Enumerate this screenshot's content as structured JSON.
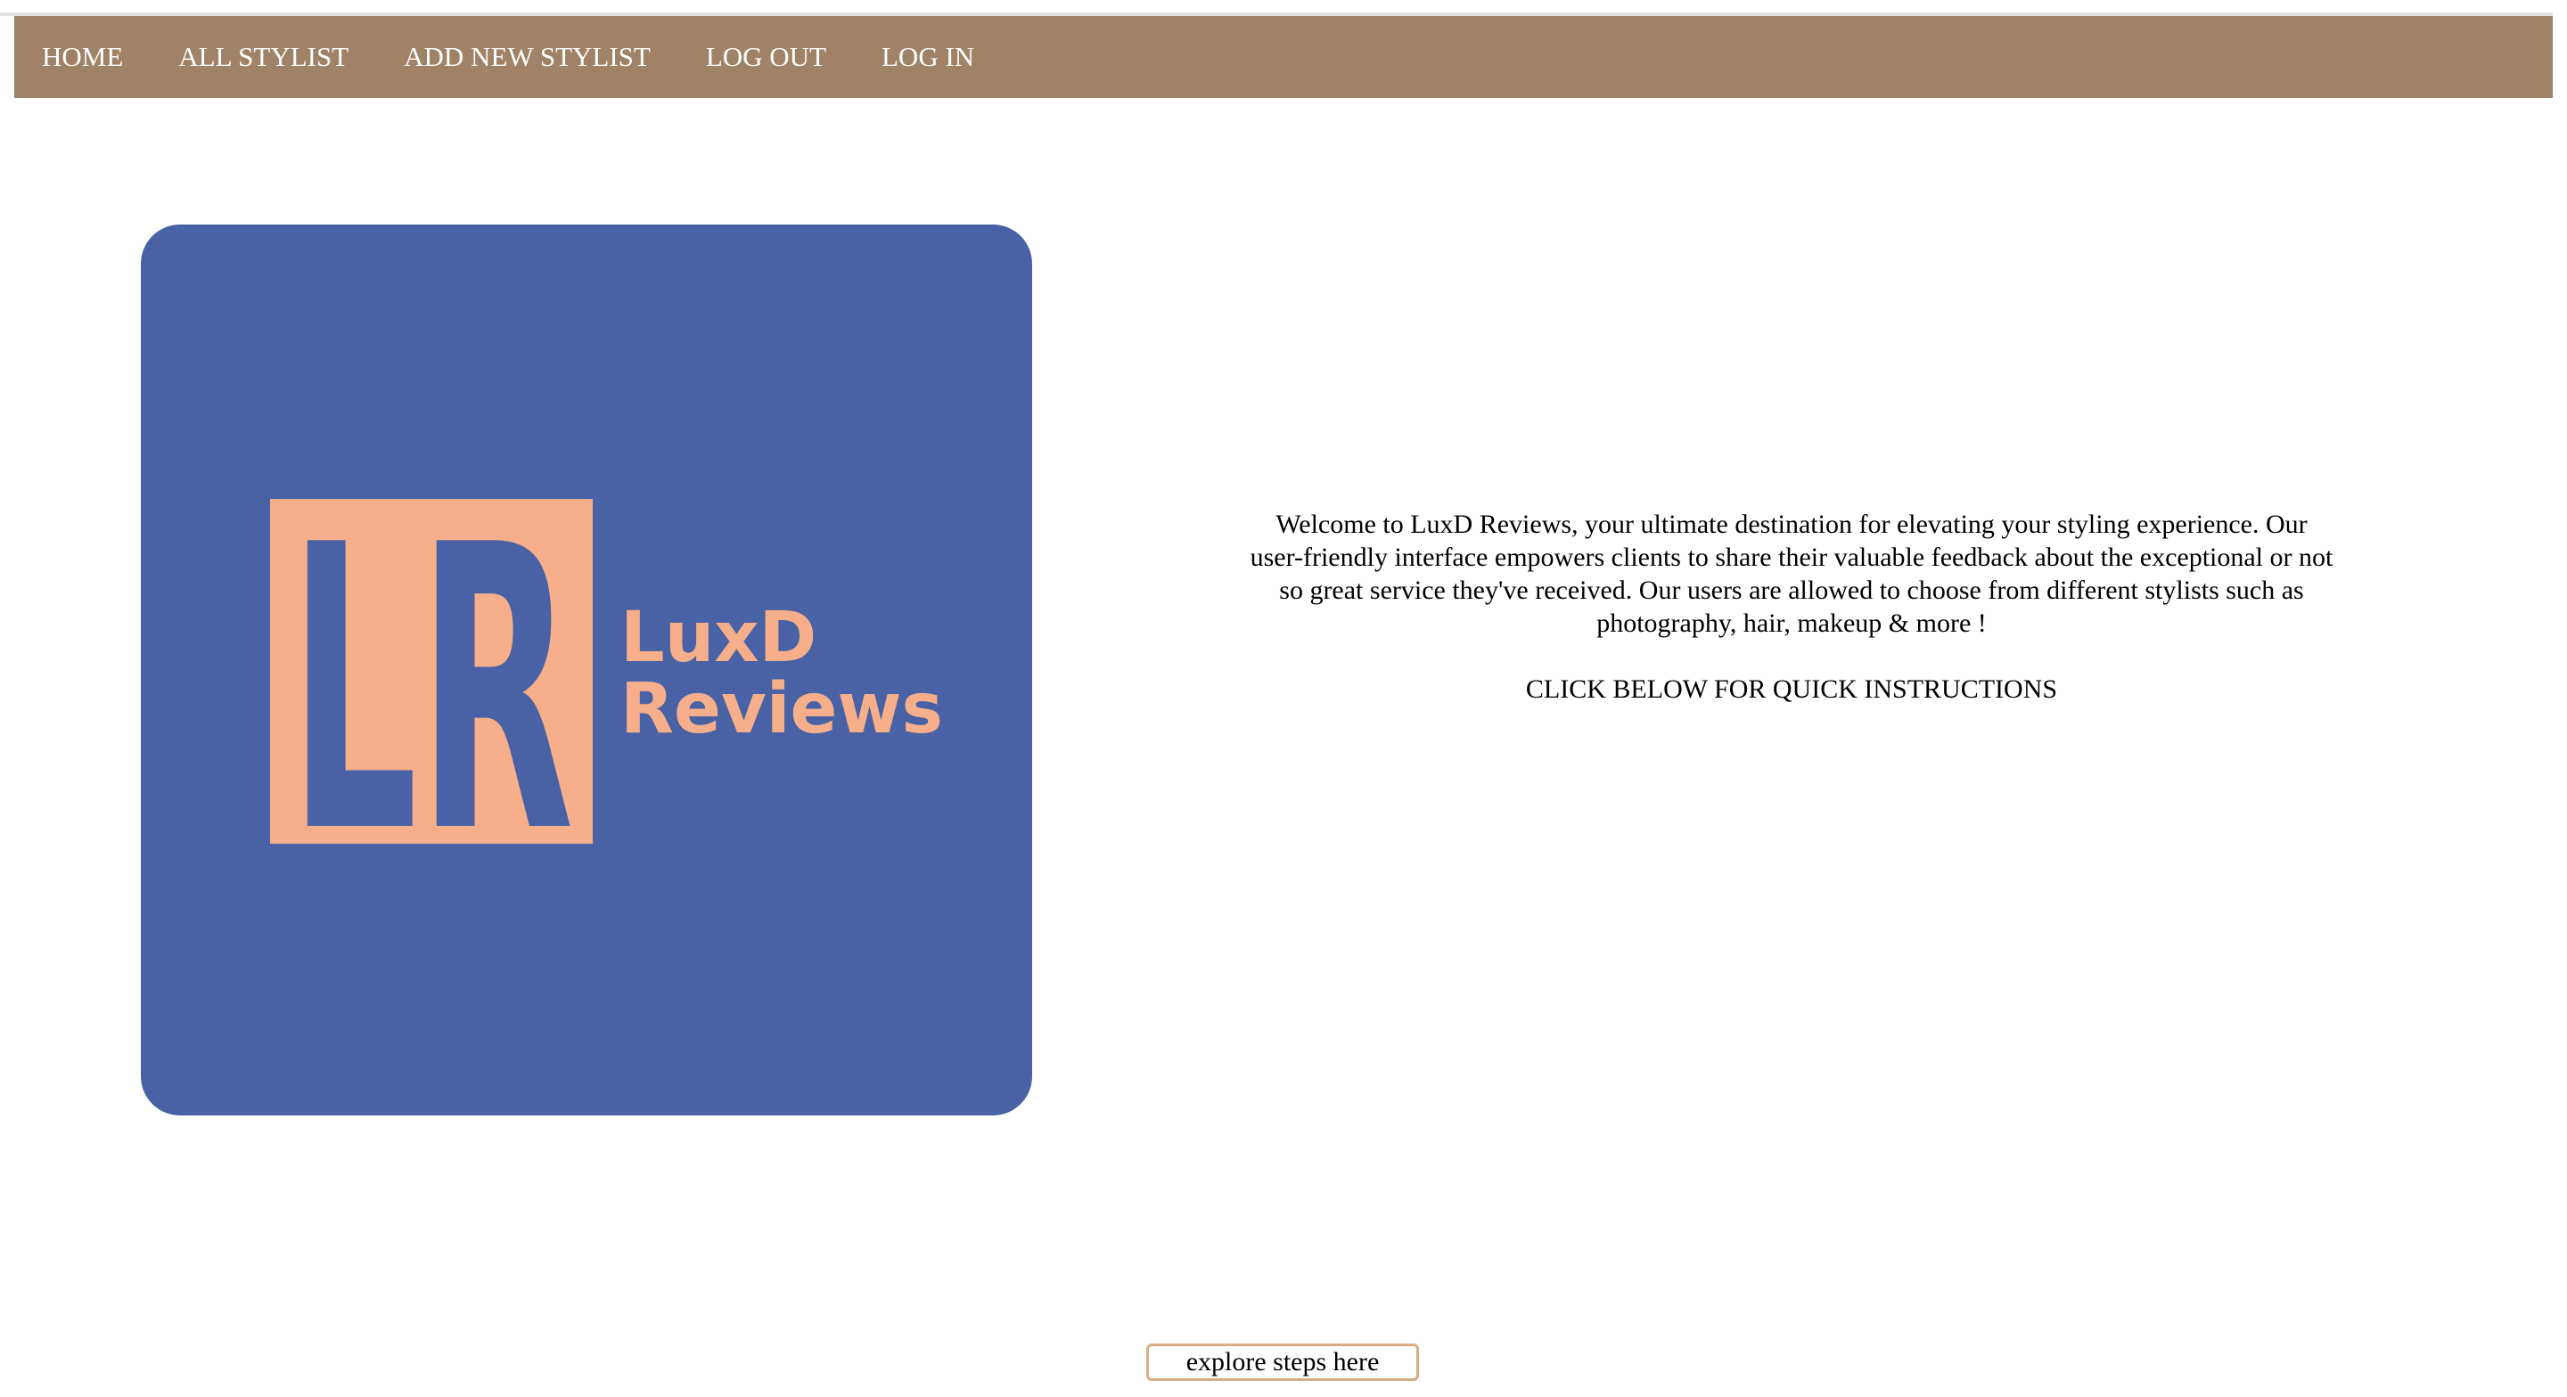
{
  "nav": {
    "items": [
      {
        "label": "HOME"
      },
      {
        "label": "ALL STYLIST"
      },
      {
        "label": "ADD NEW STYLIST"
      },
      {
        "label": "LOG OUT"
      },
      {
        "label": "LOG IN"
      }
    ]
  },
  "logo": {
    "monogram": "LR",
    "wordmark_line1": "LuxD",
    "wordmark_line2": "Reviews",
    "colors": {
      "background": "#4862a5",
      "accent": "#f7ae8b"
    }
  },
  "intro": {
    "welcome_text": "Welcome to LuxD Reviews, your ultimate destination for elevating your styling experience. Our user-friendly interface empowers clients to share their valuable feedback about the exceptional or not so great service they've received. Our users are allowed to choose from different stylists such as photography, hair, makeup & more !",
    "cta_text": "CLICK BELOW FOR QUICK INSTRUCTIONS"
  },
  "explore_button": {
    "label": "explore steps here"
  },
  "theme": {
    "nav_background": "#a08266",
    "nav_text": "#ffffff",
    "button_border": "#d7ad86"
  }
}
